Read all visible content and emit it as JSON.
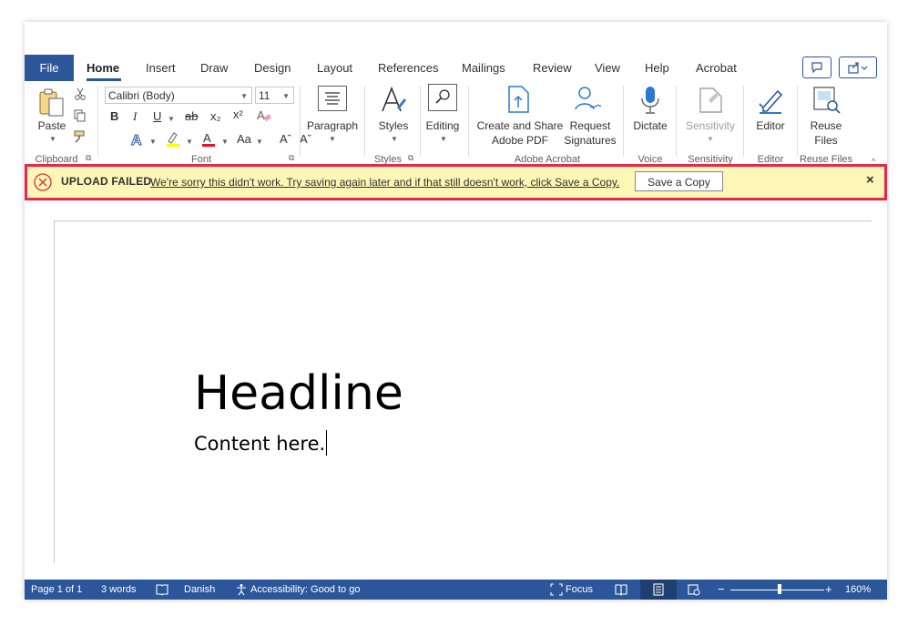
{
  "tabs": [
    {
      "label": "File"
    },
    {
      "label": "Home"
    },
    {
      "label": "Insert"
    },
    {
      "label": "Draw"
    },
    {
      "label": "Design"
    },
    {
      "label": "Layout"
    },
    {
      "label": "References"
    },
    {
      "label": "Mailings"
    },
    {
      "label": "Review"
    },
    {
      "label": "View"
    },
    {
      "label": "Help"
    },
    {
      "label": "Acrobat"
    }
  ],
  "ribbon": {
    "clipboard": {
      "paste": "Paste",
      "group": "Clipboard"
    },
    "font": {
      "name": "Calibri (Body)",
      "size": "11",
      "group": "Font",
      "bold": "B",
      "italic": "I",
      "underline": "U",
      "strike": "ab",
      "subscript": "x₂",
      "superscript": "x²",
      "change_case": "Aa",
      "grow": "Aˆ",
      "shrink": "Aˇ"
    },
    "paragraph": {
      "label": "Paragraph"
    },
    "styles": {
      "label": "Styles",
      "group": "Styles"
    },
    "editing": {
      "label": "Editing"
    },
    "acrobat": {
      "create_line1": "Create and Share",
      "create_line2": "Adobe PDF",
      "request_line1": "Request",
      "request_line2": "Signatures",
      "group": "Adobe Acrobat"
    },
    "voice": {
      "dictate": "Dictate",
      "group": "Voice"
    },
    "sensitivity": {
      "label": "Sensitivity",
      "group": "Sensitivity"
    },
    "editor": {
      "label": "Editor",
      "group": "Editor"
    },
    "reuse": {
      "line1": "Reuse",
      "line2": "Files",
      "group": "Reuse Files"
    }
  },
  "notification": {
    "title": "UPLOAD FAILED",
    "message": "We're sorry this didn't work. Try saving again later and if that still doesn't work, click Save a Copy.",
    "button": "Save a Copy",
    "close": "×",
    "colors": {
      "background": "#fcf7b6",
      "border": "#e8274b",
      "icon": "#d13438"
    }
  },
  "document": {
    "headline": "Headline",
    "content": "Content here."
  },
  "statusbar": {
    "page": "Page 1 of 1",
    "words": "3 words",
    "language": "Danish",
    "accessibility": "Accessibility: Good to go",
    "focus": "Focus",
    "zoom": "160%",
    "zoom_minus": "−",
    "zoom_plus": "+"
  },
  "colors": {
    "brand": "#2b579a"
  }
}
